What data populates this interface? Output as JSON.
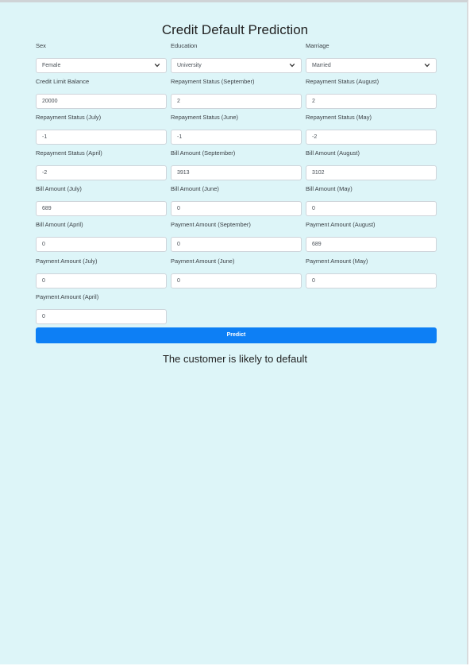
{
  "page": {
    "title": "Credit Default Prediction"
  },
  "fields": {
    "sex": {
      "label": "Sex",
      "value": "Female"
    },
    "education": {
      "label": "Education",
      "value": "University"
    },
    "marriage": {
      "label": "Marriage",
      "value": "Married"
    },
    "limit_bal": {
      "label": "Credit Limit Balance",
      "value": "20000"
    },
    "pay_sep": {
      "label": "Repayment Status (September)",
      "value": "2"
    },
    "pay_aug": {
      "label": "Repayment Status (August)",
      "value": "2"
    },
    "pay_jul": {
      "label": "Repayment Status (July)",
      "value": "-1"
    },
    "pay_jun": {
      "label": "Repayment Status (June)",
      "value": "-1"
    },
    "pay_may": {
      "label": "Repayment Status (May)",
      "value": "-2"
    },
    "pay_apr": {
      "label": "Repayment Status (April)",
      "value": "-2"
    },
    "bill_sep": {
      "label": "Bill Amount (September)",
      "value": "3913"
    },
    "bill_aug": {
      "label": "Bill Amount (August)",
      "value": "3102"
    },
    "bill_jul": {
      "label": "Bill Amount (July)",
      "value": "689"
    },
    "bill_jun": {
      "label": "Bill Amount (June)",
      "value": "0"
    },
    "bill_may": {
      "label": "Bill Amount (May)",
      "value": "0"
    },
    "bill_apr": {
      "label": "Bill Amount (April)",
      "value": "0"
    },
    "payamt_sep": {
      "label": "Payment Amount (September)",
      "value": "0"
    },
    "payamt_aug": {
      "label": "Payment Amount (August)",
      "value": "689"
    },
    "payamt_jul": {
      "label": "Payment Amount (July)",
      "value": "0"
    },
    "payamt_jun": {
      "label": "Payment Amount (June)",
      "value": "0"
    },
    "payamt_may": {
      "label": "Payment Amount (May)",
      "value": "0"
    },
    "payamt_apr": {
      "label": "Payment Amount (April)",
      "value": "0"
    }
  },
  "predict_button": {
    "label": "Predict"
  },
  "result": {
    "text": "The customer is likely to default"
  },
  "colors": {
    "background": "#ddf5f8",
    "button": "#0d7ff5"
  },
  "icons": {
    "dropdown": "chevron-down-icon"
  }
}
